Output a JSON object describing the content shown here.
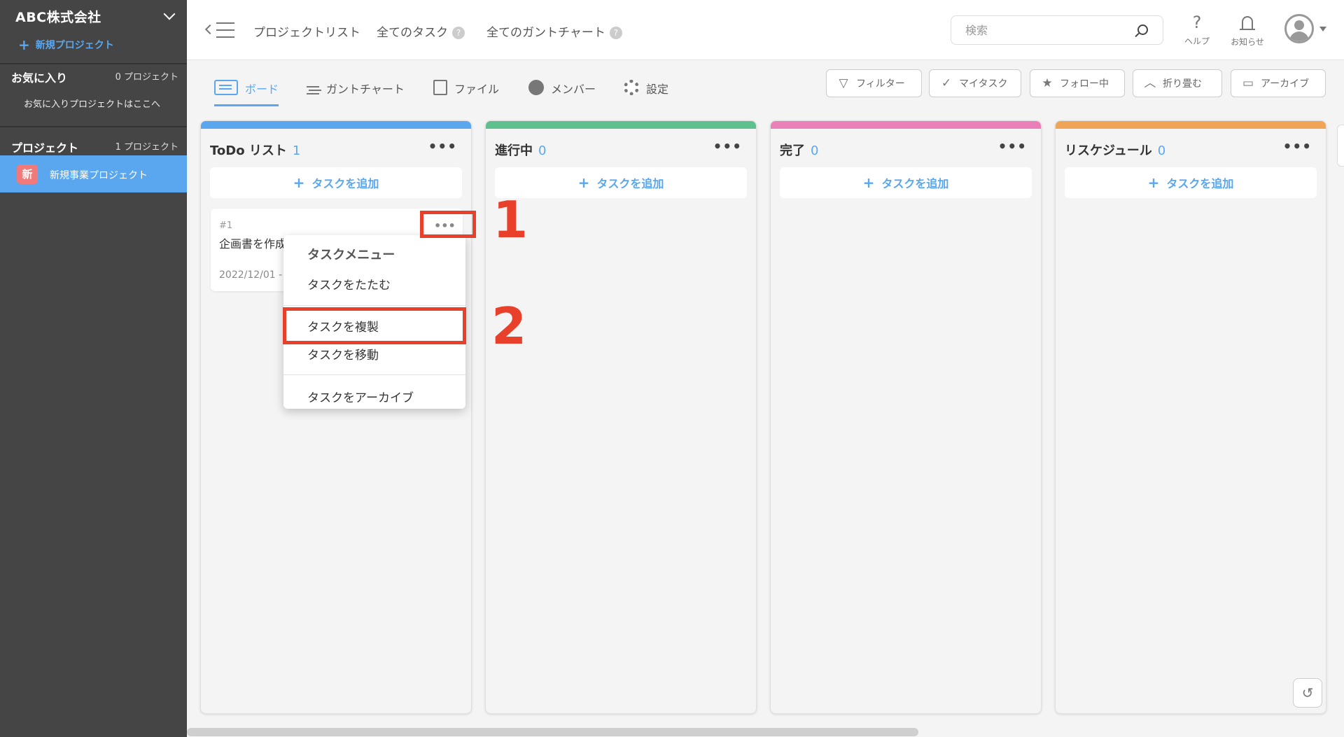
{
  "sidebar": {
    "org_name": "ABC株式会社",
    "new_project": "新規プロジェクト",
    "favorites": {
      "label": "お気に入り",
      "count": "0 プロジェクト",
      "empty_text": "お気に入りプロジェクトはここへ"
    },
    "projects": {
      "label": "プロジェクト",
      "count": "1 プロジェクト",
      "items": [
        {
          "badge": "新",
          "name": "新規事業プロジェクト"
        }
      ]
    }
  },
  "header": {
    "nav": [
      {
        "label": "プロジェクトリスト"
      },
      {
        "label": "全てのタスク",
        "help": "?"
      },
      {
        "label": "全てのガントチャート",
        "help": "?"
      }
    ],
    "search_placeholder": "検索",
    "help_label": "ヘルプ",
    "help_glyph": "?",
    "notifications_label": "お知らせ"
  },
  "tabs": [
    {
      "label": "ボード",
      "active": true
    },
    {
      "label": "ガントチャート"
    },
    {
      "label": "ファイル"
    },
    {
      "label": "メンバー"
    },
    {
      "label": "設定"
    }
  ],
  "filters": [
    {
      "label": "フィルター",
      "icon": "filter-icon"
    },
    {
      "label": "マイタスク",
      "icon": "check-icon"
    },
    {
      "label": "フォロー中",
      "icon": "star-icon"
    },
    {
      "label": "折り畳む",
      "icon": "collapse-icon"
    },
    {
      "label": "アーカイブ",
      "icon": "folder-icon"
    }
  ],
  "columns": [
    {
      "title": "ToDo リスト",
      "count": "1",
      "color": "#5aa7f0",
      "add_label": "タスクを追加"
    },
    {
      "title": "進行中",
      "count": "0",
      "color": "#5fc08f",
      "add_label": "タスクを追加"
    },
    {
      "title": "完了",
      "count": "0",
      "color": "#eb7fb8",
      "add_label": "タスクを追加"
    },
    {
      "title": "リスケジュール",
      "count": "0",
      "color": "#f0a455",
      "add_label": "タスクを追加"
    }
  ],
  "more_glyph": "•••",
  "task": {
    "id": "#1",
    "title": "企画書を作成",
    "date": "2022/12/01 -"
  },
  "task_menu": {
    "header": "タスクメニュー",
    "items": [
      "タスクをたたむ",
      "タスクを複製",
      "タスクを移動",
      "タスクをアーカイブ"
    ]
  },
  "annotations": {
    "step1": "1",
    "step2": "2"
  },
  "colors": {
    "accent": "#5aa7f0",
    "sidebar_bg": "#454545",
    "highlight": "#e8402a"
  }
}
